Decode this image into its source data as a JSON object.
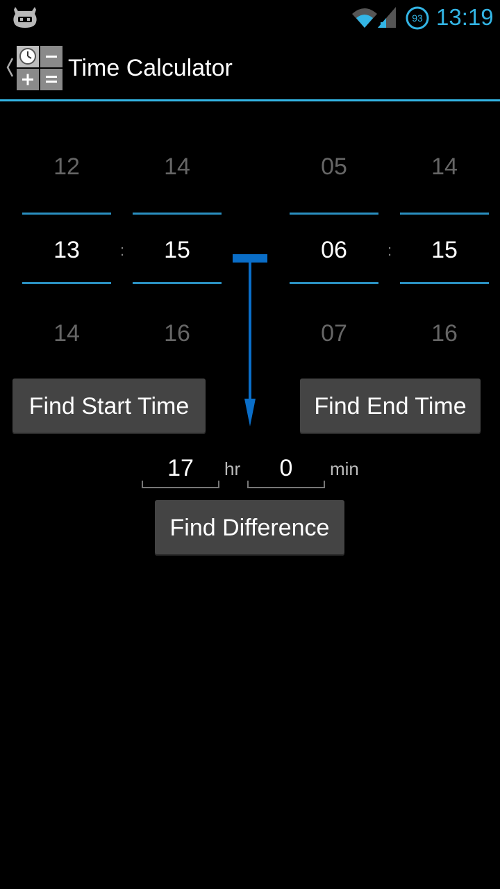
{
  "status_bar": {
    "time": "13:19",
    "battery_level": "93"
  },
  "action_bar": {
    "title": "Time Calculator"
  },
  "start_time": {
    "hour": {
      "prev": "12",
      "selected": "13",
      "next": "14"
    },
    "minute": {
      "prev": "14",
      "selected": "15",
      "next": "16"
    },
    "separator": ":"
  },
  "end_time": {
    "hour": {
      "prev": "05",
      "selected": "06",
      "next": "07"
    },
    "minute": {
      "prev": "14",
      "selected": "15",
      "next": "16"
    },
    "separator": ":"
  },
  "buttons": {
    "find_start": "Find Start Time",
    "find_end": "Find End Time",
    "find_difference": "Find Difference"
  },
  "difference": {
    "hours": "17",
    "hours_unit": "hr",
    "minutes": "0",
    "minutes_unit": "min"
  },
  "colors": {
    "accent": "#33b5e5",
    "arrow": "#0a6ec8",
    "button_bg": "#444444"
  },
  "icons": {
    "status_left": "cyanogenmod-icon",
    "wifi": "wifi-icon",
    "signal": "signal-icon",
    "battery": "battery-icon",
    "up": "chevron-left-icon",
    "app": "calculator-clock-icon"
  }
}
